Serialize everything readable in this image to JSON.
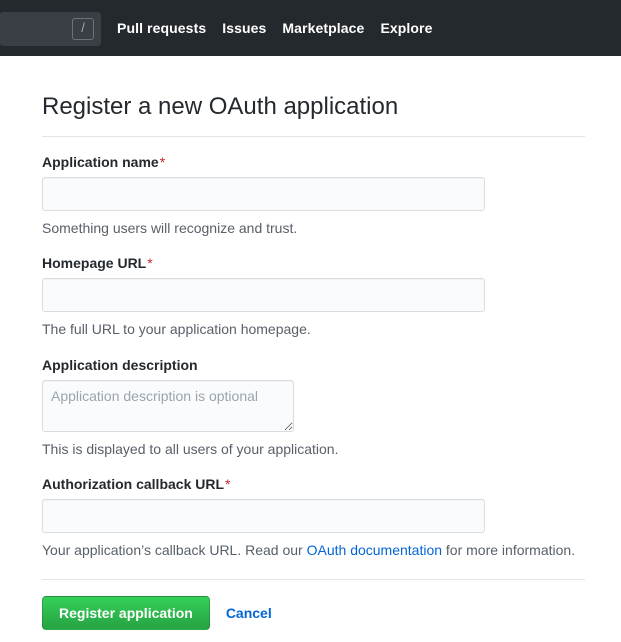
{
  "header": {
    "search": {
      "value": "",
      "placeholder": "",
      "shortcut_badge": "/"
    },
    "nav": [
      {
        "label": "Pull requests"
      },
      {
        "label": "Issues"
      },
      {
        "label": "Marketplace"
      },
      {
        "label": "Explore"
      }
    ]
  },
  "page": {
    "title": "Register a new OAuth application"
  },
  "form": {
    "required_marker": "*",
    "fields": [
      {
        "label": "Application name",
        "required": true,
        "value": "",
        "placeholder": "",
        "help": "Something users will recognize and trust."
      },
      {
        "label": "Homepage URL",
        "required": true,
        "value": "",
        "placeholder": "",
        "help": "The full URL to your application homepage."
      },
      {
        "label": "Application description",
        "required": false,
        "value": "",
        "placeholder": "Application description is optional",
        "help": "This is displayed to all users of your application."
      },
      {
        "label": "Authorization callback URL",
        "required": true,
        "value": "",
        "placeholder": "",
        "help_before": "Your application’s callback URL. Read our ",
        "help_link": "OAuth documentation",
        "help_after": " for more information."
      }
    ],
    "submit_label": "Register application",
    "cancel_label": "Cancel"
  },
  "colors": {
    "header_bg": "#24292e",
    "accent_green": "#28a745",
    "link_blue": "#0366d6",
    "required_red": "#cb2431",
    "help_gray": "#586069"
  }
}
